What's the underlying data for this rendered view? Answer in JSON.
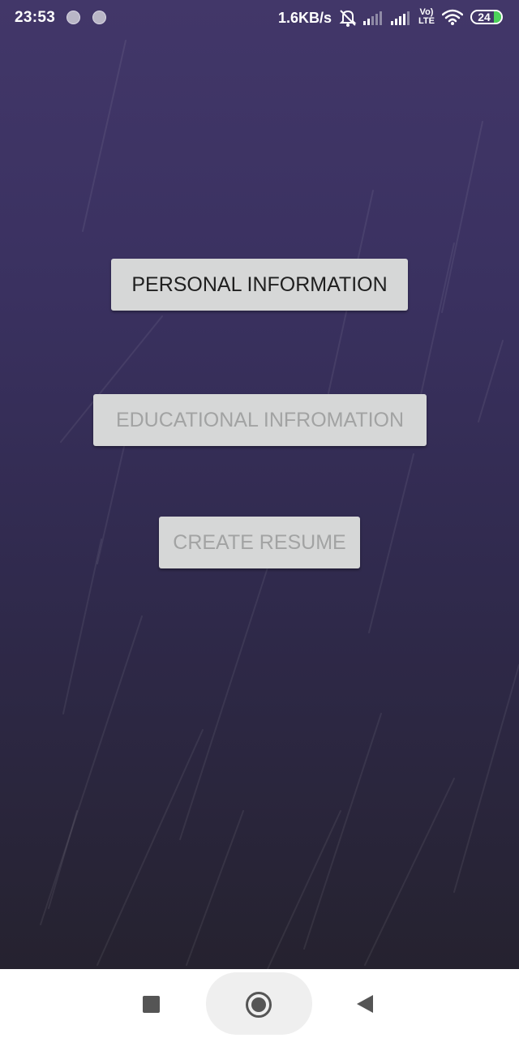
{
  "status_bar": {
    "time": "23:53",
    "net_speed": "1.6KB/s",
    "volte_top": "Vo)",
    "volte_bottom": "LTE",
    "battery_level": "24",
    "icons": [
      "notification-dot-icon",
      "notification-dot-icon",
      "alarm-off-icon",
      "signal-icon",
      "signal-icon",
      "volte-icon",
      "wifi-icon",
      "battery-icon"
    ]
  },
  "main": {
    "buttons": {
      "personal_information": "PERSONAL INFORMATION",
      "educational_information": "EDUCATIONAL INFROMATION",
      "create_resume": "CREATE RESUME"
    }
  },
  "nav_bar": {
    "icons": [
      "recents-icon",
      "home-icon",
      "back-icon"
    ]
  },
  "colors": {
    "background_top": "#423769",
    "background_bottom": "#25222f",
    "button_bg": "#d6d7d7",
    "button_text_active": "#1f1f1f",
    "button_text_disabled": "#a2a3a3",
    "battery_fill": "#4cd35a"
  }
}
